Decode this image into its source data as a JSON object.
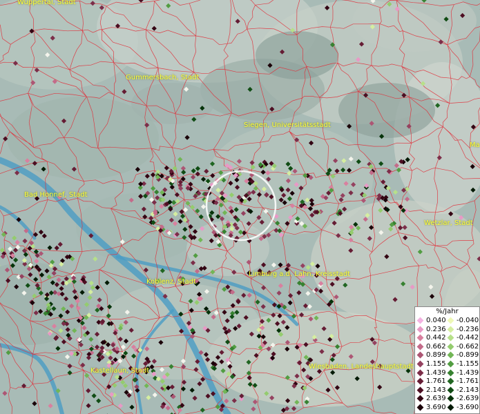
{
  "map": {
    "cities": [
      {
        "name": "Wuppertal, Stadt"
      },
      {
        "name": "Gummersbach, Stadt"
      },
      {
        "name": "Siegen, Universitätsstadt"
      },
      {
        "name": "Bad Honnef, Stadt"
      },
      {
        "name": "Wetzlar, Stadt"
      },
      {
        "name": "Koblenz, Stadt"
      },
      {
        "name": "Limburg a.d. Lahn, Kreisstadt"
      },
      {
        "name": "Kastellaun, Stadt"
      },
      {
        "name": "Wiesbaden, Landeshauptstadt"
      },
      {
        "name": "Ma"
      }
    ]
  },
  "legend": {
    "title": "%/Jahr",
    "positive": [
      {
        "label": "0.040",
        "color": "#f4b2e2"
      },
      {
        "label": "0.236",
        "color": "#e899c6"
      },
      {
        "label": "0.442",
        "color": "#d9809f"
      },
      {
        "label": "0.662",
        "color": "#c46b8a"
      },
      {
        "label": "0.899",
        "color": "#ad5674"
      },
      {
        "label": "1.155",
        "color": "#954260"
      },
      {
        "label": "1.439",
        "color": "#7c2e49"
      },
      {
        "label": "1.761",
        "color": "#651c34"
      },
      {
        "label": "2.143",
        "color": "#4d0e22"
      },
      {
        "label": "2.639",
        "color": "#330513"
      },
      {
        "label": "3.690",
        "color": "#1a0008"
      }
    ],
    "negative": [
      {
        "label": "-0.040",
        "color": "#eef8b6"
      },
      {
        "label": "-0.236",
        "color": "#d5eea0"
      },
      {
        "label": "-0.442",
        "color": "#b7e08a"
      },
      {
        "label": "-0.662",
        "color": "#94cc6e"
      },
      {
        "label": "-0.899",
        "color": "#72b656"
      },
      {
        "label": "-1.155",
        "color": "#529d42"
      },
      {
        "label": "-1.439",
        "color": "#378231"
      },
      {
        "label": "-1.761",
        "color": "#216622"
      },
      {
        "label": "-2.143",
        "color": "#104c14"
      },
      {
        "label": "-2.639",
        "color": "#06330a"
      },
      {
        "label": "-3.690",
        "color": "#021a04"
      }
    ]
  }
}
